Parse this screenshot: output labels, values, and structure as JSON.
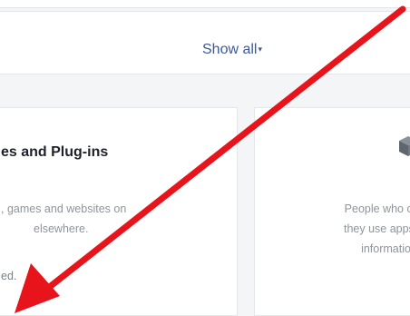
{
  "toolbar": {
    "show_all_label": "Show all",
    "caret": "▾"
  },
  "panels": {
    "left": {
      "title": "es and Plug-ins",
      "desc_lines": [
        ", games and websites on",
        "elsewhere."
      ],
      "status": "ed."
    },
    "right": {
      "icon": "cube-icon",
      "desc_lines": [
        "People who can s",
        "they use apps. Us",
        "information"
      ]
    }
  },
  "annotation": {
    "arrow_color": "#e8141b"
  },
  "colors": {
    "link": "#3b5998",
    "muted_text": "#8d949e",
    "heading": "#1d2129"
  }
}
